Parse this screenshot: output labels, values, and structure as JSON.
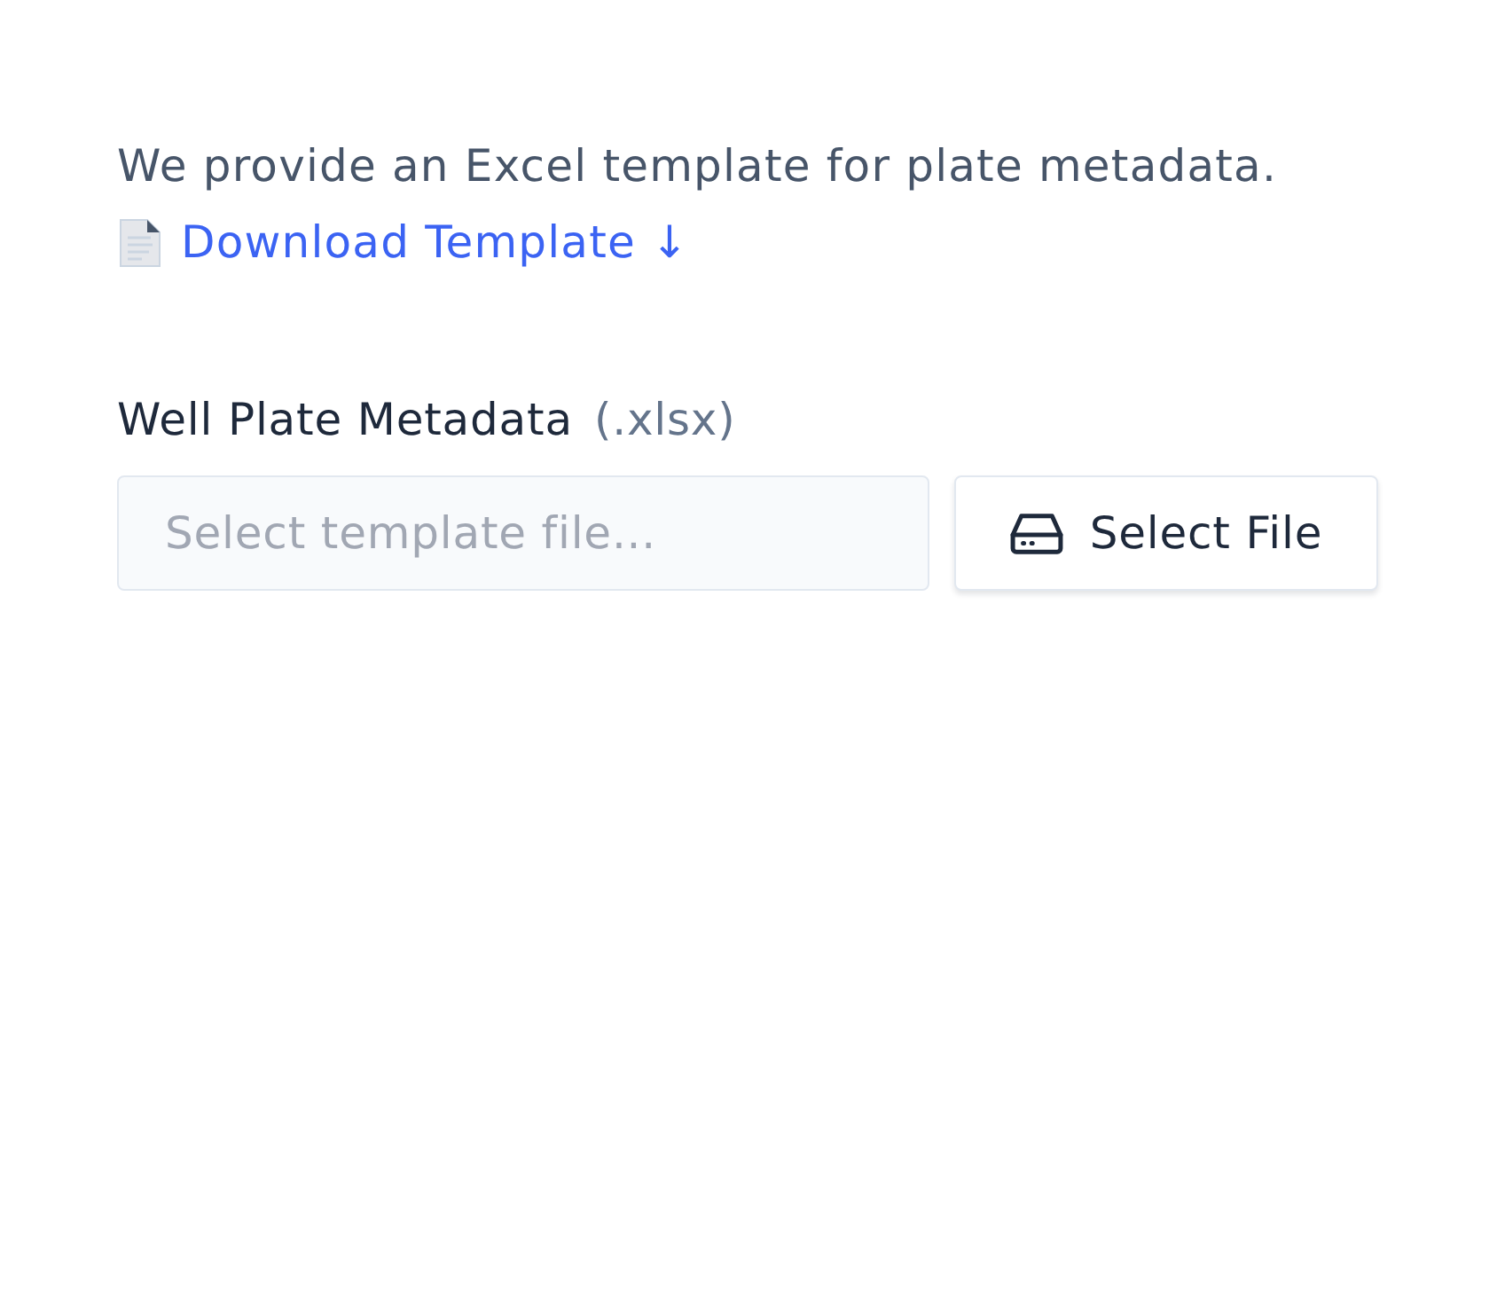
{
  "intro": {
    "text": "We provide an Excel template for plate metadata."
  },
  "download_link": {
    "label": "Download Template ↓"
  },
  "field": {
    "label": "Well Plate Metadata",
    "hint": "(.xlsx)",
    "placeholder": "Select template file..."
  },
  "button": {
    "label": "Select File"
  }
}
